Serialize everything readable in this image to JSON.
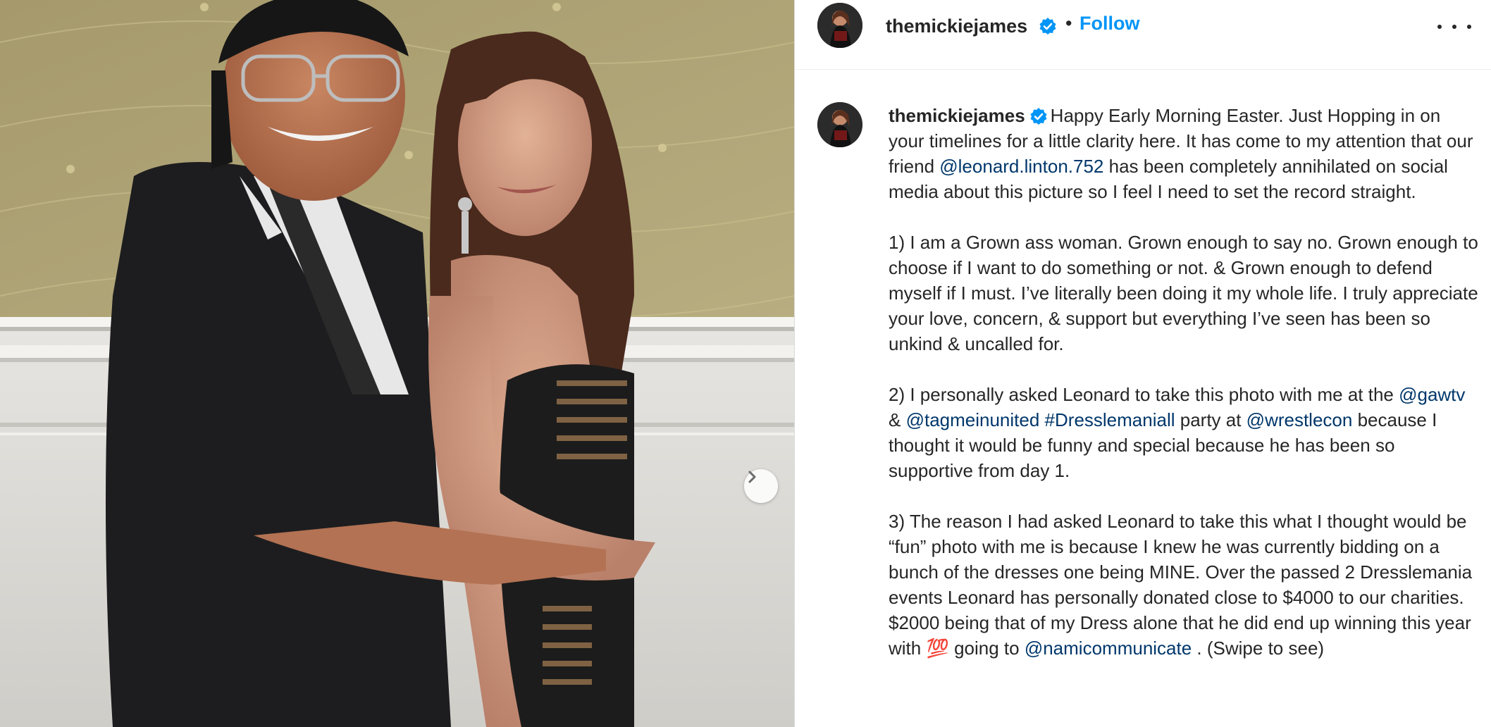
{
  "post": {
    "username": "themickiejames",
    "separator": "•",
    "follow_label": "Follow",
    "more_icon": "more-options-icon",
    "next_icon": "chevron-right-icon",
    "verified_icon": "verified-badge-icon"
  },
  "caption": {
    "username": "themickiejames",
    "p1": {
      "text_a": "Happy Early Morning Easter. Just Hopping in on your timelines for a little clarity here. It has come to my attention that our friend ",
      "mention": "@leonard.linton.752",
      "text_b": " has been completely annihilated on social media about this picture so I feel I need to set the record straight."
    },
    "p2": "1) I am a Grown ass woman. Grown enough to say no. Grown enough to choose if I want to do something or not. & Grown enough to defend myself if I must. I’ve literally been doing it my whole life. I truly appreciate your love, concern, & support but everything I’ve seen has been so unkind & uncalled for.",
    "p3": {
      "text_a": "2) I personally asked Leonard to take this photo with me at the ",
      "mention_1": "@gawtv",
      "text_b": " & ",
      "mention_2": "@tagmeinunited",
      "text_c": " ",
      "hashtag": "#Dresslemaniall",
      "text_d": " party at ",
      "mention_3": "@wrestlecon",
      "text_e": " because I thought it would be funny and special because he has been so supportive from day 1."
    },
    "p4": {
      "text_a": "3) The reason I had asked Leonard to take this what I thought would be “fun” photo with me is because I knew he was currently bidding on a bunch of the dresses one being MINE. Over the passed 2 Dresslemania events Leonard has personally donated close to $4000 to our charities. $2000 being that of my Dress alone that he did end up winning this year with ",
      "emoji": "💯",
      "text_b": " going to ",
      "mention": "@namicommunicate",
      "text_c": " . (Swipe to see)"
    }
  },
  "colors": {
    "link": "#00376b",
    "follow": "#0095f6",
    "verified": "#0095f6",
    "text": "#262626"
  }
}
